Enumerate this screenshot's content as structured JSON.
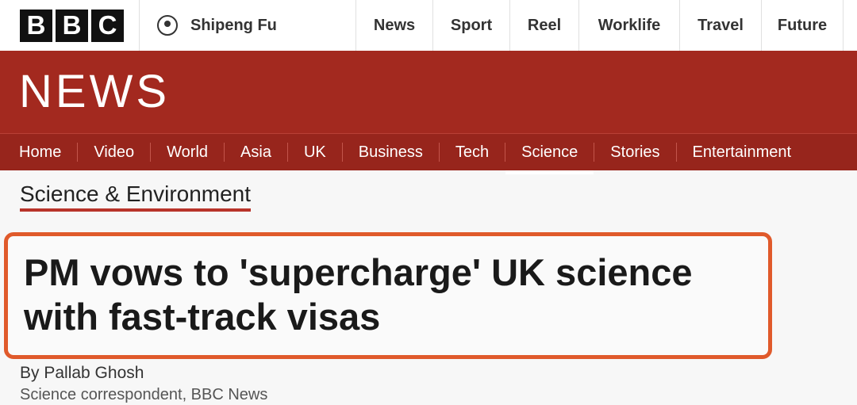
{
  "logo": {
    "letters": [
      "B",
      "B",
      "C"
    ]
  },
  "account": {
    "name": "Shipeng Fu",
    "icon": "account-icon"
  },
  "top_nav": [
    "News",
    "Sport",
    "Reel",
    "Worklife",
    "Travel",
    "Future"
  ],
  "banner": {
    "title": "NEWS"
  },
  "main_nav": {
    "items": [
      "Home",
      "Video",
      "World",
      "Asia",
      "UK",
      "Business",
      "Tech",
      "Science",
      "Stories",
      "Entertainment"
    ],
    "active": "Science"
  },
  "section": {
    "title": "Science & Environment"
  },
  "article": {
    "headline": "PM vows to 'supercharge' UK science with fast-track visas",
    "byline": "By Pallab Ghosh",
    "role": "Science correspondent, BBC News"
  },
  "colors": {
    "banner": "#a3291f",
    "highlight_border": "#e05a2b",
    "section_underline": "#b8342a"
  }
}
